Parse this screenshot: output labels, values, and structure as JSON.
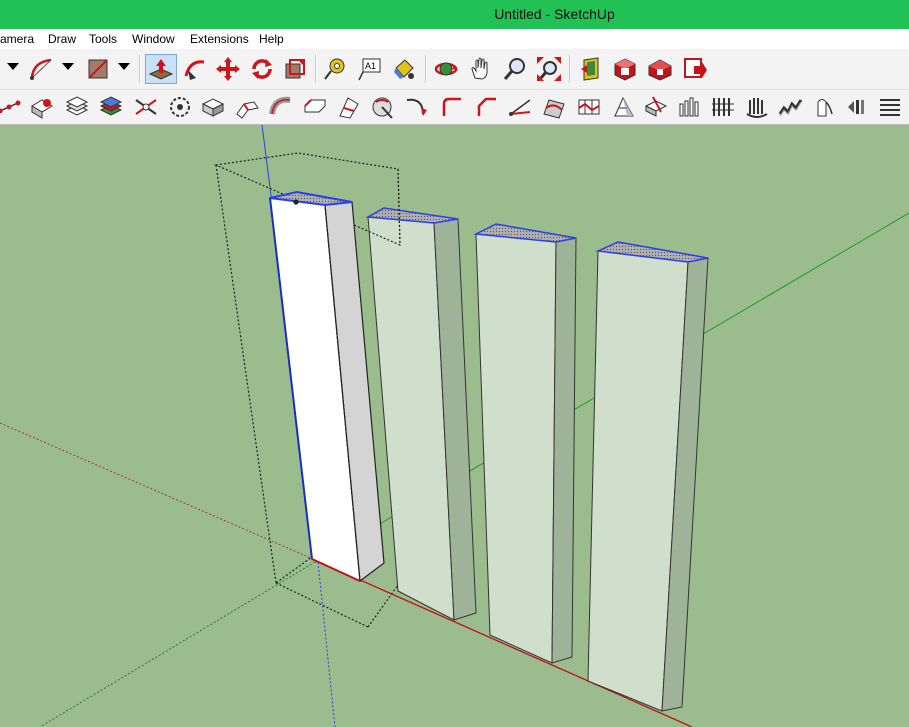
{
  "window": {
    "title": "Untitled - SketchUp"
  },
  "menu": {
    "items": [
      "amera",
      "Draw",
      "Tools",
      "Window",
      "Extensions",
      "Help"
    ]
  },
  "toolbar_top": {
    "tools": [
      "arc-tool",
      "rectangle-tool",
      "push-pull-tool",
      "follow-me-tool",
      "move-tool",
      "rotate-tool",
      "scale-tool",
      "tape-measure-tool",
      "text-tool",
      "paint-bucket-tool",
      "orbit-tool",
      "pan-tool",
      "zoom-tool",
      "zoom-extents-tool",
      "section-plane-tool",
      "3d-warehouse",
      "extension-warehouse",
      "layout-send"
    ],
    "active_tool": "push-pull-tool",
    "text_tool_label": "A1"
  },
  "toolbar_bottom": {
    "tools": [
      "fredo-line",
      "round-corner",
      "layers",
      "stack-layers",
      "explode",
      "select-vertices",
      "push-vertices",
      "bend",
      "curve",
      "chamfer",
      "section-cut",
      "knife",
      "arc-edge",
      "corner",
      "bevel",
      "offset",
      "split-faces",
      "joint-push",
      "extrude",
      "slice",
      "wire",
      "fence",
      "roll",
      "wave",
      "cylinder",
      "helix",
      "blend",
      "panel"
    ]
  },
  "colors": {
    "title_bar": "#22c156",
    "background": "#9bbd8d",
    "selection": "#2b3fe8",
    "face_light": "#cfdfcb",
    "face_shade": "#9fb399",
    "selected_face": "#ffffff"
  },
  "scene": {
    "objects": [
      "selected-box",
      "box-2",
      "box-3",
      "box-4"
    ],
    "selected_index": 0
  }
}
